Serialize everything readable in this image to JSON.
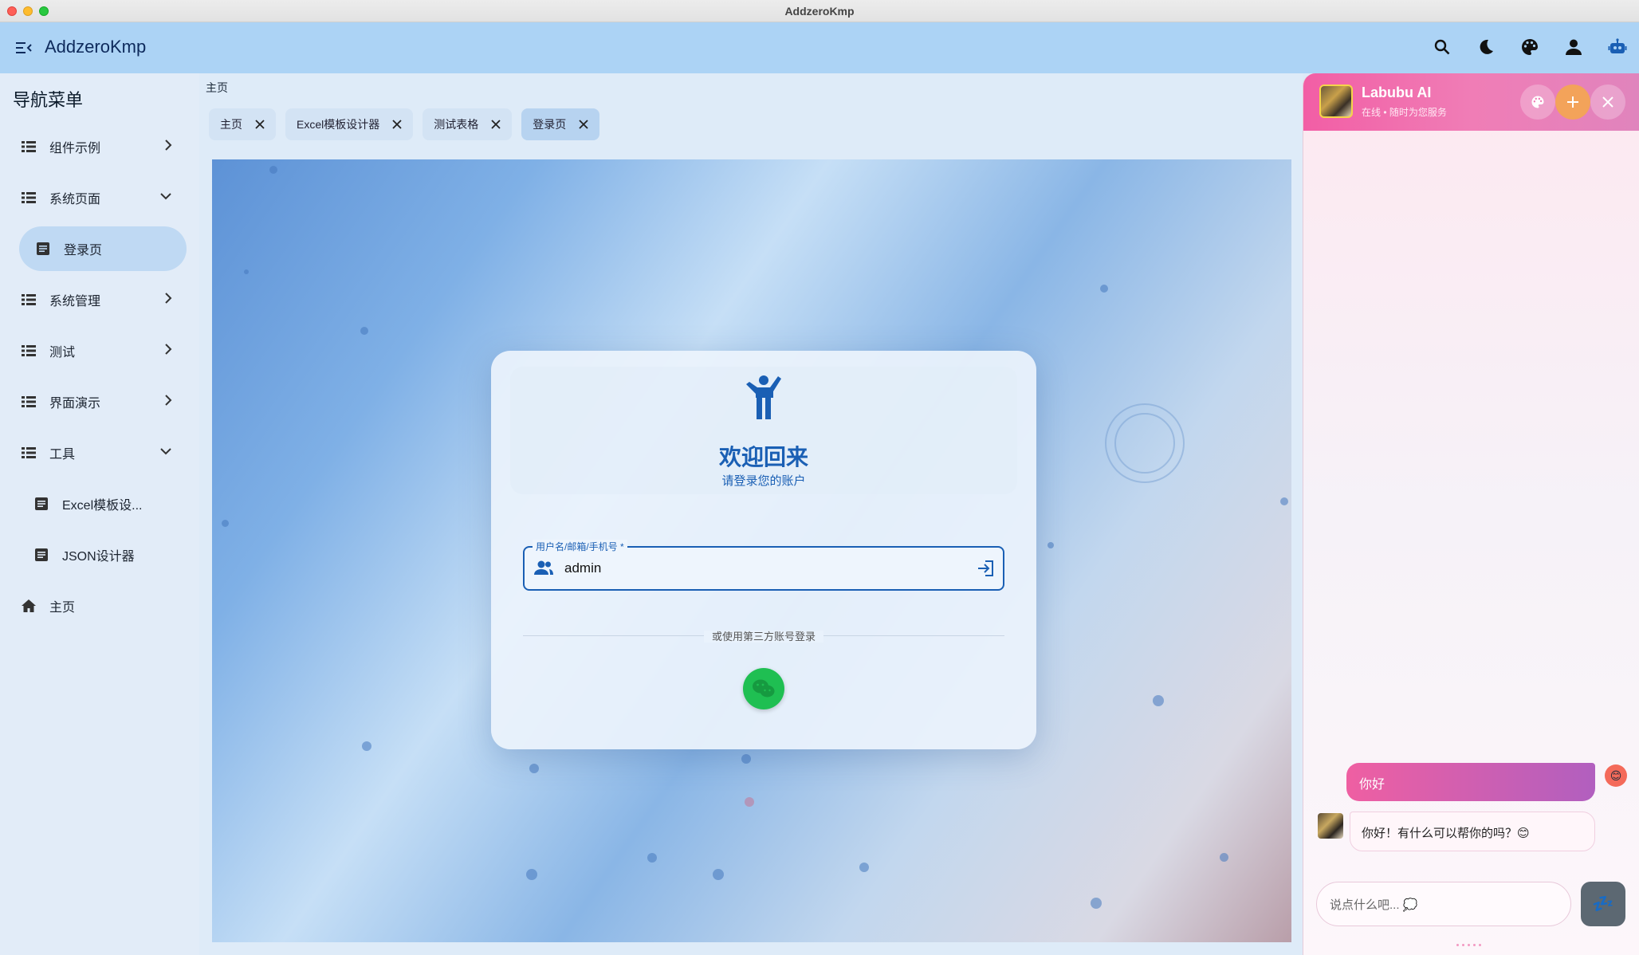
{
  "window": {
    "title": "AddzeroKmp"
  },
  "appbar": {
    "app_name": "AddzeroKmp",
    "actions": [
      "search-icon",
      "dark-mode-icon",
      "palette-icon",
      "account-icon",
      "robot-icon"
    ]
  },
  "sidebar": {
    "title": "导航菜单",
    "items": [
      {
        "label": "组件示例"
      },
      {
        "label": "系统页面"
      },
      {
        "label": "登录页"
      },
      {
        "label": "系统管理"
      },
      {
        "label": "测试"
      },
      {
        "label": "界面演示"
      },
      {
        "label": "工具"
      },
      {
        "label": "Excel模板设..."
      },
      {
        "label": "JSON设计器"
      },
      {
        "label": "主页"
      }
    ]
  },
  "main": {
    "breadcrumb": "主页",
    "tabs": [
      {
        "label": "主页"
      },
      {
        "label": "Excel模板设计器"
      },
      {
        "label": "测试表格"
      },
      {
        "label": "登录页"
      }
    ]
  },
  "login": {
    "title": "欢迎回来",
    "subtitle": "请登录您的账户",
    "username_label": "用户名/邮箱/手机号 *",
    "username_value": "admin",
    "divider_text": "或使用第三方账号登录"
  },
  "chat": {
    "name": "Labubu AI",
    "status": "在线 • 随时为您服务",
    "messages": [
      {
        "role": "user",
        "text": "你好"
      },
      {
        "role": "bot",
        "text": "你好！有什么可以帮你的吗？😊"
      }
    ],
    "input_placeholder": "说点什么吧... 💭",
    "send_label": "💤",
    "user_emoji": "😊"
  },
  "colors": {
    "appbar": "#acd3f5",
    "primary": "#1a5fb4",
    "chat_header": "#f25ea5",
    "wechat": "#1fbf52"
  }
}
